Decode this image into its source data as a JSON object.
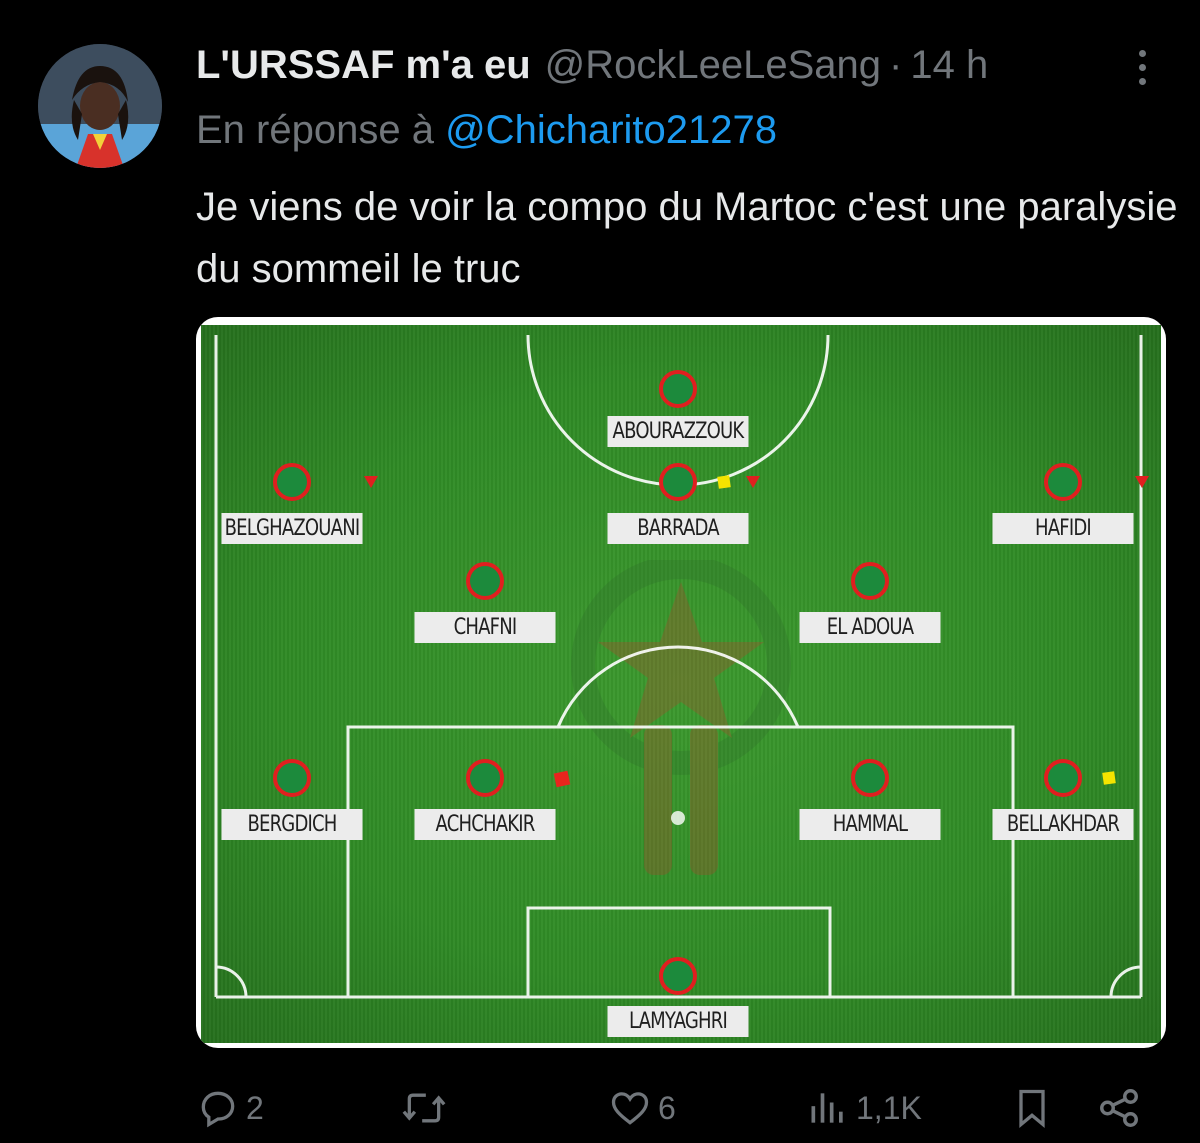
{
  "tweet": {
    "display_name": "L'URSSAF m'a eu",
    "handle": "@RockLeeLeSang",
    "separator": "·",
    "time": "14 h",
    "reply_prefix": "En réponse à",
    "reply_to": "@Chicharito21278",
    "text": "Je viens de voir la compo du Martoc c'est une paralysie du sommeil le truc"
  },
  "lineup": {
    "players": [
      {
        "name": "ABOURAZZOUK",
        "markers": []
      },
      {
        "name": "BELGHAZOUANI",
        "markers": [
          "sub-arrow"
        ]
      },
      {
        "name": "BARRADA",
        "markers": [
          "yellow-card",
          "sub-arrow"
        ]
      },
      {
        "name": "HAFIDI",
        "markers": [
          "sub-arrow"
        ]
      },
      {
        "name": "CHAFNI",
        "markers": []
      },
      {
        "name": "EL ADOUA",
        "markers": []
      },
      {
        "name": "BERGDICH",
        "markers": []
      },
      {
        "name": "ACHCHAKIR",
        "markers": [
          "red-card"
        ]
      },
      {
        "name": "HAMMAL",
        "markers": []
      },
      {
        "name": "BELLAKHDAR",
        "markers": [
          "yellow-card"
        ]
      },
      {
        "name": "LAMYAGHRI",
        "markers": []
      }
    ],
    "colors": {
      "pitch": "#2f8a25",
      "dot_fill": "#1c8a3c",
      "dot_ring": "#e01f1f",
      "label_bg": "#ececec"
    }
  },
  "actions": {
    "reply": {
      "icon": "reply-icon",
      "count": "2"
    },
    "retweet": {
      "icon": "retweet-icon",
      "count": ""
    },
    "like": {
      "icon": "heart-icon",
      "count": "6"
    },
    "views": {
      "icon": "views-icon",
      "count": "1,1K"
    },
    "bookmark": {
      "icon": "bookmark-icon"
    },
    "share": {
      "icon": "share-icon"
    }
  },
  "theme": {
    "background": "#000000",
    "text": "#e7e9ea",
    "muted": "#71767b",
    "link": "#1d9bf0"
  }
}
